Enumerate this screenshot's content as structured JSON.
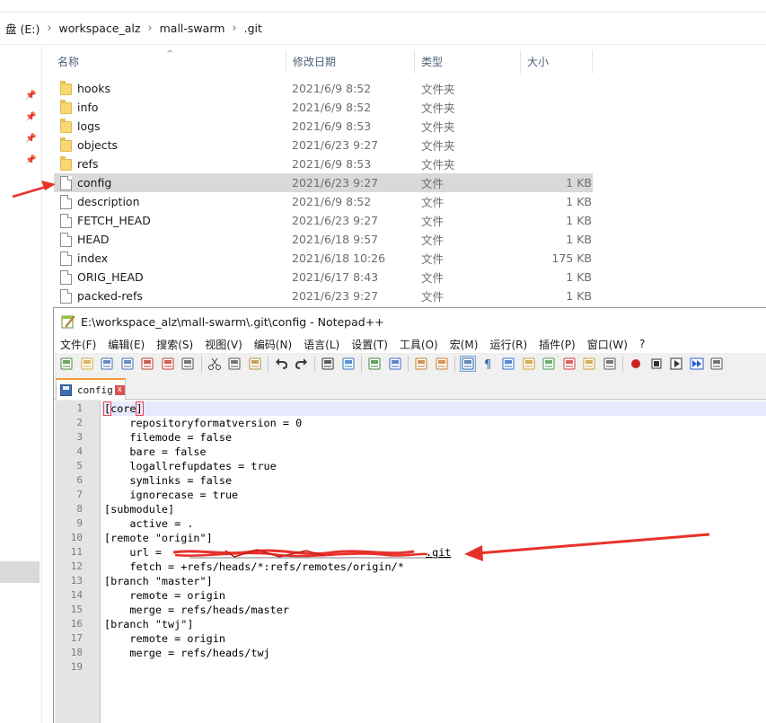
{
  "explorer": {
    "breadcrumb": [
      "盘 (E:)",
      "workspace_alz",
      "mall-swarm",
      ".git"
    ],
    "breadcrumb_sep": "›",
    "columns": {
      "name": "名称",
      "date": "修改日期",
      "type": "类型",
      "size": "大小"
    },
    "sort_arrow": "^",
    "pins": [
      "pin-icon",
      "pin-icon",
      "pin-icon",
      "pin-icon"
    ],
    "files": [
      {
        "name": "hooks",
        "date": "2021/6/9 8:52",
        "type": "文件夹",
        "size": "",
        "icon": "folder-icon"
      },
      {
        "name": "info",
        "date": "2021/6/9 8:52",
        "type": "文件夹",
        "size": "",
        "icon": "folder-icon"
      },
      {
        "name": "logs",
        "date": "2021/6/9 8:53",
        "type": "文件夹",
        "size": "",
        "icon": "folder-icon"
      },
      {
        "name": "objects",
        "date": "2021/6/23 9:27",
        "type": "文件夹",
        "size": "",
        "icon": "folder-icon"
      },
      {
        "name": "refs",
        "date": "2021/6/9 8:53",
        "type": "文件夹",
        "size": "",
        "icon": "folder-icon"
      },
      {
        "name": "config",
        "date": "2021/6/23 9:27",
        "type": "文件",
        "size": "1 KB",
        "icon": "file-icon",
        "selected": true
      },
      {
        "name": "description",
        "date": "2021/6/9 8:52",
        "type": "文件",
        "size": "1 KB",
        "icon": "file-icon"
      },
      {
        "name": "FETCH_HEAD",
        "date": "2021/6/23 9:27",
        "type": "文件",
        "size": "1 KB",
        "icon": "file-icon"
      },
      {
        "name": "HEAD",
        "date": "2021/6/18 9:57",
        "type": "文件",
        "size": "1 KB",
        "icon": "file-icon"
      },
      {
        "name": "index",
        "date": "2021/6/18 10:26",
        "type": "文件",
        "size": "175 KB",
        "icon": "file-icon"
      },
      {
        "name": "ORIG_HEAD",
        "date": "2021/6/17 8:43",
        "type": "文件",
        "size": "1 KB",
        "icon": "file-icon"
      },
      {
        "name": "packed-refs",
        "date": "2021/6/23 9:27",
        "type": "文件",
        "size": "1 KB",
        "icon": "file-icon"
      }
    ]
  },
  "notepad": {
    "title": "E:\\workspace_alz\\mall-swarm\\.git\\config - Notepad++",
    "menu": [
      "文件(F)",
      "编辑(E)",
      "搜索(S)",
      "视图(V)",
      "编码(N)",
      "语言(L)",
      "设置(T)",
      "工具(O)",
      "宏(M)",
      "运行(R)",
      "插件(P)",
      "窗口(W)",
      "?"
    ],
    "toolbar_icons": [
      "new-file-icon",
      "open-file-icon",
      "save-icon",
      "save-all-icon",
      "close-icon",
      "close-all-icon",
      "print-icon",
      "sep",
      "cut-icon",
      "copy-icon",
      "paste-icon",
      "sep",
      "undo-icon",
      "redo-icon",
      "sep",
      "find-icon",
      "replace-icon",
      "sep",
      "zoom-in-icon",
      "zoom-out-icon",
      "sep",
      "sync-v-icon",
      "sync-h-icon",
      "sep",
      "word-wrap-icon",
      "show-all-chars-icon",
      "indent-guide-icon",
      "user-lang-icon",
      "doc-map-icon",
      "function-list-icon",
      "folder-workspace-icon",
      "monitoring-icon",
      "sep",
      "record-macro-icon",
      "stop-macro-icon",
      "play-macro-icon",
      "run-macro-multiple-icon",
      "save-macro-icon"
    ],
    "tab": {
      "label": "config",
      "close": "x"
    },
    "lines": [
      "[core]",
      "    repositoryformatversion = 0",
      "    filemode = false",
      "    bare = false",
      "    logallrefupdates = true",
      "    symlinks = false",
      "    ignorecase = true",
      "[submodule]",
      "    active = .",
      "[remote \"origin\"]",
      "    url = ",
      "    fetch = +refs/heads/*:refs/remotes/origin/*",
      "[branch \"master\"]",
      "    remote = origin",
      "    merge = refs/heads/master",
      "[branch \"twj\"]",
      "    remote = origin",
      "    merge = refs/heads/twj",
      ""
    ],
    "url_visible_suffix": ".git",
    "current_line": 1
  },
  "colors": {
    "annotation_red": "#e8302a",
    "tab_accent": "#f79b3c",
    "selection_gray": "#d9d9d9"
  }
}
